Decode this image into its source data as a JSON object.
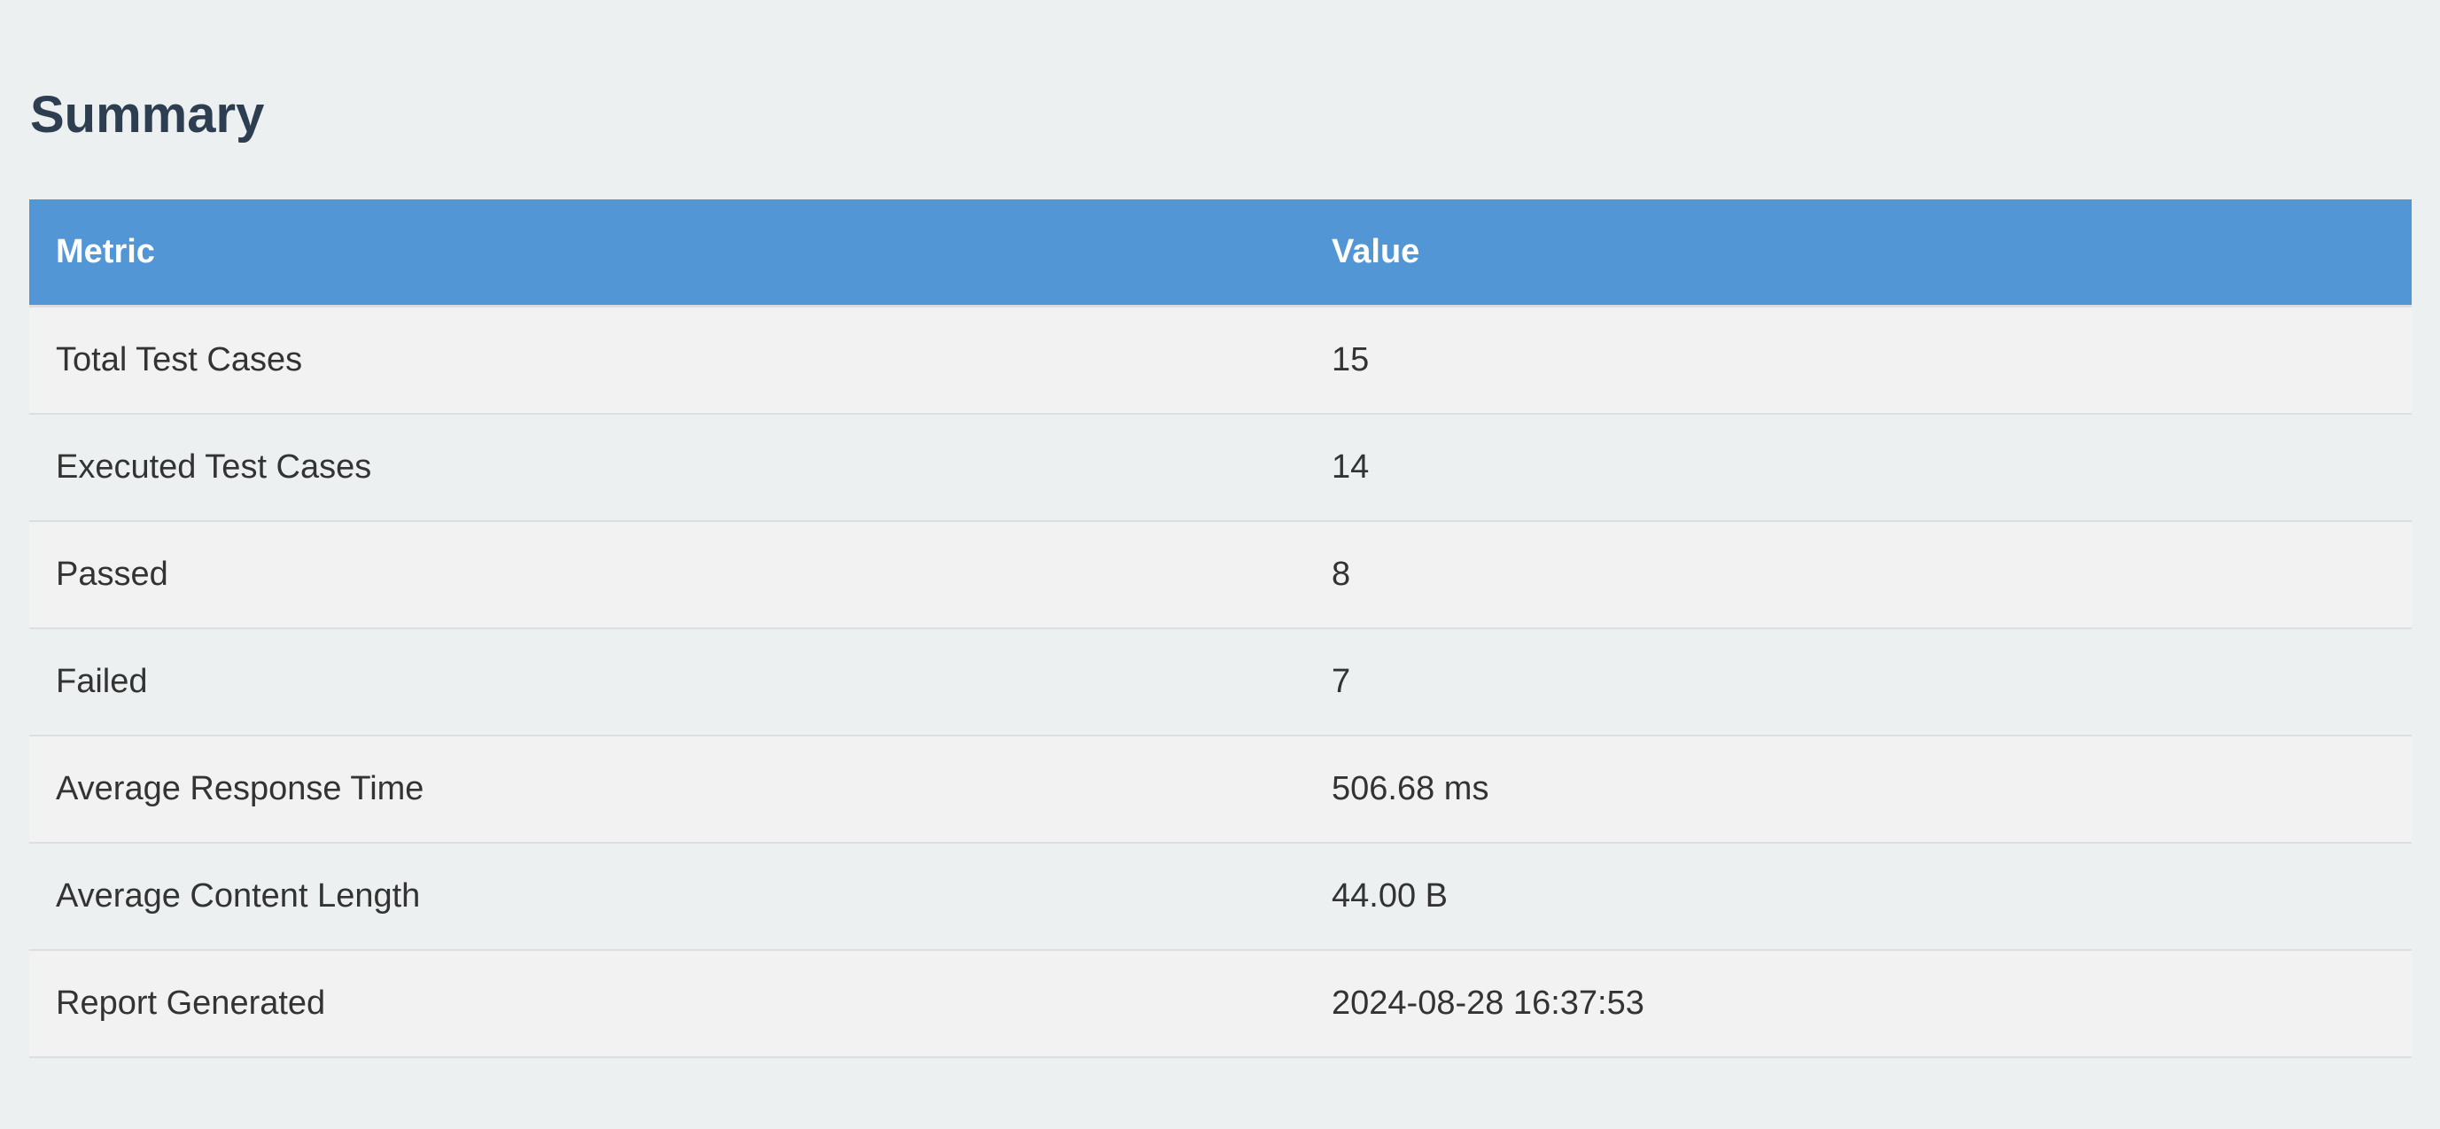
{
  "title": "Summary",
  "table": {
    "headers": [
      "Metric",
      "Value"
    ],
    "rows": [
      [
        "Total Test Cases",
        "15"
      ],
      [
        "Executed Test Cases",
        "14"
      ],
      [
        "Passed",
        "8"
      ],
      [
        "Failed",
        "7"
      ],
      [
        "Average Response Time",
        "506.68 ms"
      ],
      [
        "Average Content Length",
        "44.00 B"
      ],
      [
        "Report Generated",
        "2024-08-28 16:37:53"
      ]
    ]
  },
  "colors": {
    "header_bg": "#5296d5",
    "title": "#2c3e50",
    "page_bg": "#ecf0f1"
  }
}
